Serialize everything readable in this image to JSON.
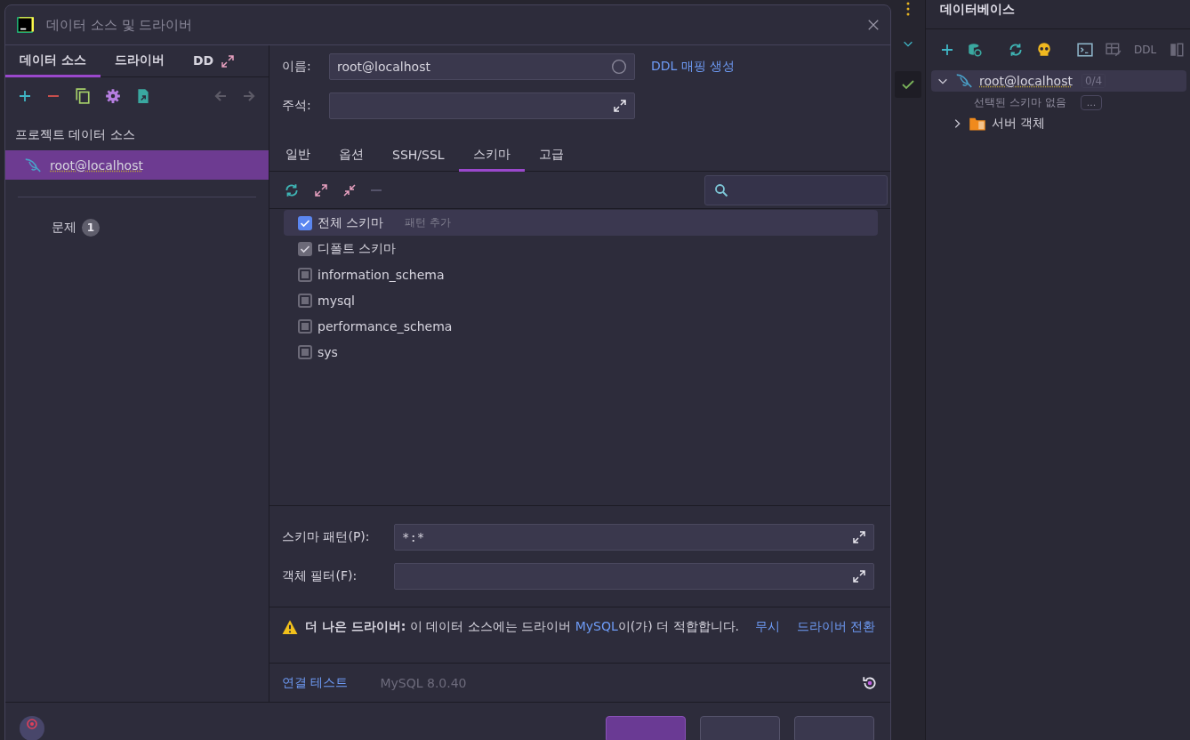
{
  "database_panel": {
    "title": "데이터베이스",
    "toolbar_label": "DDL",
    "tree": [
      {
        "kind": "datasource",
        "label": "root@localhost",
        "badge": "0/4",
        "expanded": true,
        "children": [
          {
            "kind": "note",
            "label": "선택된 스키마 없음",
            "button": "..."
          },
          {
            "kind": "folder",
            "label": "서버 객체",
            "expanded": false
          }
        ]
      }
    ]
  },
  "dialog": {
    "title": "데이터 소스 및 드라이버",
    "left_tabs": [
      {
        "label": "데이터 소스",
        "selected": true
      },
      {
        "label": "드라이버",
        "selected": false
      },
      {
        "label": "DD",
        "selected": false
      }
    ],
    "section_title": "프로젝트 데이터 소스",
    "data_sources": [
      {
        "label": "root@localhost",
        "selected": true
      }
    ],
    "problems": {
      "label": "문제",
      "count": "1"
    },
    "name_label": "이름:",
    "name_value": "root@localhost",
    "ddl_link": "DDL 매핑 생성",
    "comment_label": "주석:",
    "tabs": [
      {
        "label": "일반",
        "selected": false
      },
      {
        "label": "옵션",
        "selected": false
      },
      {
        "label": "SSH/SSL",
        "selected": false
      },
      {
        "label": "스키마",
        "selected": true
      },
      {
        "label": "고급",
        "selected": false
      }
    ],
    "schemas": [
      {
        "kind": "all",
        "label": "전체 스키마",
        "hint": "패턴 추가",
        "checked": true,
        "implied": false,
        "selected": true
      },
      {
        "kind": "default",
        "label": "디폴트 스키마",
        "checked": true,
        "implied": true,
        "selected": false
      },
      {
        "kind": "schema",
        "label": "information_schema",
        "checked": true,
        "implied": true,
        "selected": false
      },
      {
        "kind": "schema",
        "label": "mysql",
        "checked": true,
        "implied": true,
        "selected": false
      },
      {
        "kind": "schema",
        "label": "performance_schema",
        "checked": true,
        "implied": true,
        "selected": false
      },
      {
        "kind": "schema",
        "label": "sys",
        "checked": true,
        "implied": true,
        "selected": false
      }
    ],
    "schema_pattern": {
      "label": "스키마 패턴(P):",
      "value": "*:*"
    },
    "object_filter": {
      "label": "객체 필터(F):"
    },
    "warning": {
      "text": "**더 나은 드라이버:** 이 데이터 소스에는 드라이버 ",
      "link": "MySQL",
      "text_after": "이(가) 더 적합합니다.",
      "actions": [
        "무시",
        "드라이버 전환"
      ]
    },
    "test_link": "연결 테스트",
    "driver_version": "MySQL 8.0.40",
    "buttons": [
      {
        "primary": true
      },
      {
        "primary": false
      },
      {
        "primary": false
      }
    ]
  }
}
